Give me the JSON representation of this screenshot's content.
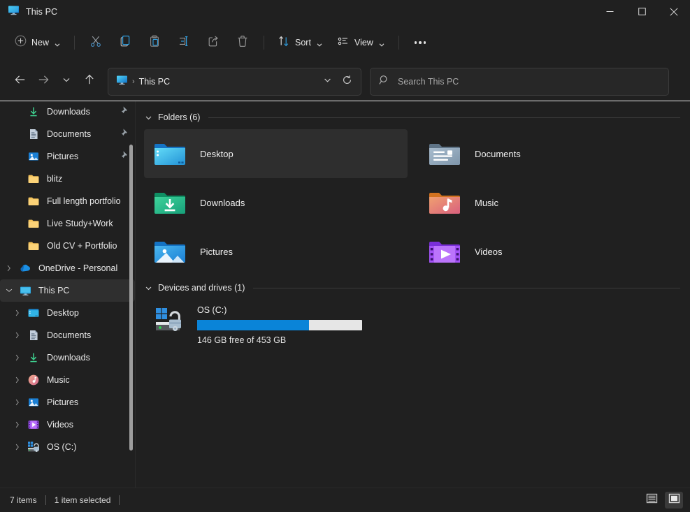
{
  "window": {
    "title": "This PC",
    "title_icon": "this-pc-monitor-icon",
    "controls": {
      "minimize": "minimize-icon",
      "maximize": "maximize-icon",
      "close": "close-icon"
    }
  },
  "toolbar": {
    "new_label": "New",
    "sort_label": "Sort",
    "view_label": "View",
    "items": [
      {
        "name": "new-button",
        "icon": "plus-circle-icon"
      },
      {
        "name": "cut-button",
        "icon": "scissors-icon"
      },
      {
        "name": "copy-button",
        "icon": "copy-icon"
      },
      {
        "name": "paste-button",
        "icon": "clipboard-icon"
      },
      {
        "name": "rename-button",
        "icon": "rename-icon"
      },
      {
        "name": "share-button",
        "icon": "share-icon"
      },
      {
        "name": "delete-button",
        "icon": "trash-icon"
      },
      {
        "name": "sort-button",
        "icon": "sort-arrows-icon"
      },
      {
        "name": "view-button",
        "icon": "view-list-icon"
      },
      {
        "name": "more-options-button",
        "icon": "ellipsis-icon"
      }
    ]
  },
  "navigation": {
    "back": "back-arrow-icon",
    "forward": "forward-arrow-icon",
    "recent": "chevron-down-icon",
    "up": "up-arrow-icon",
    "address": {
      "icon": "this-pc-monitor-icon",
      "separator": "›",
      "crumb": "This PC",
      "dropdown": "chevron-down-icon",
      "refresh": "refresh-icon"
    },
    "search": {
      "icon": "search-icon",
      "placeholder": "Search This PC",
      "value": ""
    }
  },
  "sidebar": {
    "items": [
      {
        "label": "Downloads",
        "icon": "downloads-icon",
        "indent": 1,
        "twisty": "none",
        "pinned": true,
        "selected": false
      },
      {
        "label": "Documents",
        "icon": "documents-icon",
        "indent": 1,
        "twisty": "none",
        "pinned": true,
        "selected": false
      },
      {
        "label": "Pictures",
        "icon": "pictures-icon",
        "indent": 1,
        "twisty": "none",
        "pinned": true,
        "selected": false
      },
      {
        "label": "blitz",
        "icon": "folder-icon",
        "indent": 1,
        "twisty": "none",
        "pinned": false,
        "selected": false
      },
      {
        "label": "Full length portfolio",
        "icon": "folder-icon",
        "indent": 1,
        "twisty": "none",
        "pinned": false,
        "selected": false
      },
      {
        "label": "Live Study+Work",
        "icon": "folder-icon",
        "indent": 1,
        "twisty": "none",
        "pinned": false,
        "selected": false
      },
      {
        "label": "Old CV + Portfolio",
        "icon": "folder-icon",
        "indent": 1,
        "twisty": "none",
        "pinned": false,
        "selected": false
      },
      {
        "label": "OneDrive - Personal",
        "icon": "onedrive-icon",
        "indent": 0,
        "twisty": "right",
        "pinned": false,
        "selected": false
      },
      {
        "label": "This PC",
        "icon": "this-pc-monitor-icon",
        "indent": 0,
        "twisty": "down",
        "pinned": false,
        "selected": true
      },
      {
        "label": "Desktop",
        "icon": "desktop-folder-icon",
        "indent": 1,
        "twisty": "right",
        "pinned": false,
        "selected": false
      },
      {
        "label": "Documents",
        "icon": "documents-icon",
        "indent": 1,
        "twisty": "right",
        "pinned": false,
        "selected": false
      },
      {
        "label": "Downloads",
        "icon": "downloads-icon",
        "indent": 1,
        "twisty": "right",
        "pinned": false,
        "selected": false
      },
      {
        "label": "Music",
        "icon": "music-icon",
        "indent": 1,
        "twisty": "right",
        "pinned": false,
        "selected": false
      },
      {
        "label": "Pictures",
        "icon": "pictures-icon",
        "indent": 1,
        "twisty": "right",
        "pinned": false,
        "selected": false
      },
      {
        "label": "Videos",
        "icon": "videos-icon",
        "indent": 1,
        "twisty": "right",
        "pinned": false,
        "selected": false
      },
      {
        "label": "OS (C:)",
        "icon": "drive-bitlocker-icon",
        "indent": 1,
        "twisty": "right",
        "pinned": false,
        "selected": false
      }
    ]
  },
  "content": {
    "folders_group": {
      "title": "Folders (6)",
      "chevron": "chevron-down-icon",
      "items": [
        {
          "label": "Desktop",
          "icon": "desktop-folder-icon",
          "selected": true
        },
        {
          "label": "Documents",
          "icon": "documents-folder-icon",
          "selected": false
        },
        {
          "label": "Downloads",
          "icon": "downloads-folder-icon",
          "selected": false
        },
        {
          "label": "Music",
          "icon": "music-folder-icon",
          "selected": false
        },
        {
          "label": "Pictures",
          "icon": "pictures-folder-icon",
          "selected": false
        },
        {
          "label": "Videos",
          "icon": "videos-folder-icon",
          "selected": false
        }
      ]
    },
    "devices_group": {
      "title": "Devices and drives (1)",
      "chevron": "chevron-down-icon",
      "drives": [
        {
          "name": "OS (C:)",
          "icon": "drive-bitlocker-icon",
          "capacity_text": "146 GB free of 453 GB",
          "free_gb": 146,
          "total_gb": 453,
          "used_percent": 68,
          "bar_fill_color": "#0a84d8",
          "bar_track_color": "#e6e6e6"
        }
      ]
    }
  },
  "statusbar": {
    "item_count": "7 items",
    "selection": "1 item selected",
    "views": [
      {
        "name": "details-view-button",
        "icon": "details-view-icon",
        "active": false
      },
      {
        "name": "large-icons-view-button",
        "icon": "large-icons-view-icon",
        "active": true
      }
    ]
  },
  "colors": {
    "background": "#202020",
    "selection": "#2e2e2e",
    "accent": "#0a84d8",
    "text": "#e8e8e8",
    "muted_text": "#a8a8a8"
  }
}
